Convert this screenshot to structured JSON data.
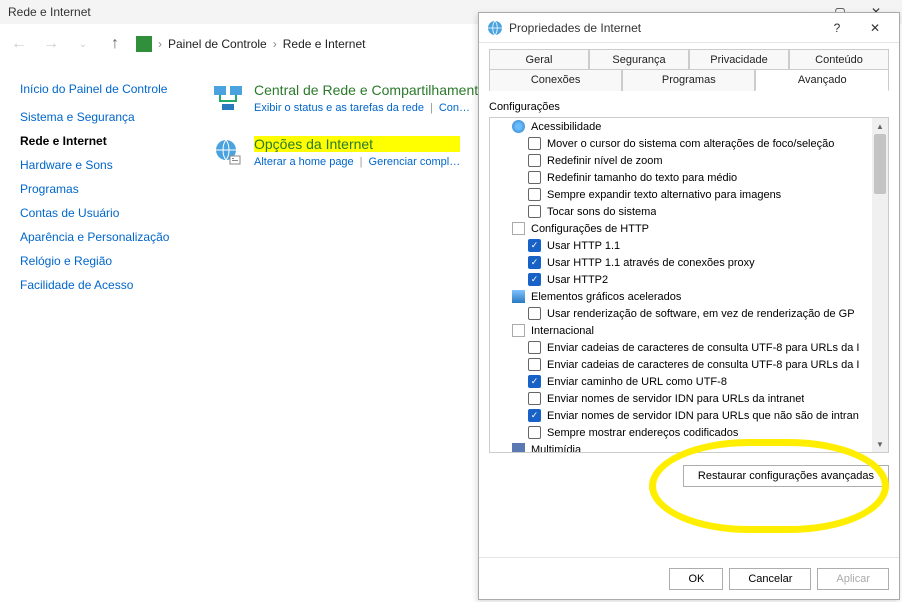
{
  "cp": {
    "title": "Rede e Internet",
    "breadcrumb": {
      "root": "Painel de Controle",
      "current": "Rede e Internet"
    },
    "home_link": "Início do Painel de Controle",
    "categories": [
      {
        "label": "Sistema e Segurança",
        "active": false
      },
      {
        "label": "Rede e Internet",
        "active": true
      },
      {
        "label": "Hardware e Sons",
        "active": false
      },
      {
        "label": "Programas",
        "active": false
      },
      {
        "label": "Contas de Usuário",
        "active": false
      },
      {
        "label": "Aparência e Personalização",
        "active": false
      },
      {
        "label": "Relógio e Região",
        "active": false
      },
      {
        "label": "Facilidade de Acesso",
        "active": false
      }
    ],
    "items": [
      {
        "title": "Central de Rede e Compartilhamento",
        "highlight": false,
        "links": [
          "Exibir o status e as tarefas da rede",
          "Con…"
        ]
      },
      {
        "title": "Opções da Internet",
        "highlight": true,
        "links": [
          "Alterar a home page",
          "Gerenciar compl…"
        ]
      }
    ]
  },
  "dialog": {
    "title": "Propriedades de Internet",
    "tabs_row1": [
      "Geral",
      "Segurança",
      "Privacidade",
      "Conteúdo"
    ],
    "tabs_row2": [
      "Conexões",
      "Programas",
      "Avançado"
    ],
    "active_tab": "Avançado",
    "group_label": "Configurações",
    "tree": [
      {
        "type": "group",
        "icon": "acc",
        "label": "Acessibilidade"
      },
      {
        "type": "check",
        "checked": false,
        "label": "Mover o cursor do sistema com alterações de foco/seleção"
      },
      {
        "type": "check",
        "checked": false,
        "label": "Redefinir nível de zoom"
      },
      {
        "type": "check",
        "checked": false,
        "label": "Redefinir tamanho do texto para médio"
      },
      {
        "type": "check",
        "checked": false,
        "label": "Sempre expandir texto alternativo para imagens"
      },
      {
        "type": "check",
        "checked": false,
        "label": "Tocar sons do sistema"
      },
      {
        "type": "group",
        "icon": "http",
        "label": "Configurações de HTTP"
      },
      {
        "type": "check",
        "checked": true,
        "label": "Usar HTTP 1.1"
      },
      {
        "type": "check",
        "checked": true,
        "label": "Usar HTTP 1.1 através de conexões proxy"
      },
      {
        "type": "check",
        "checked": true,
        "label": "Usar HTTP2"
      },
      {
        "type": "group",
        "icon": "gfx",
        "label": "Elementos gráficos acelerados"
      },
      {
        "type": "check",
        "checked": false,
        "label": "Usar renderização de software, em vez de renderização de GP"
      },
      {
        "type": "group",
        "icon": "intl",
        "label": "Internacional"
      },
      {
        "type": "check",
        "checked": false,
        "label": "Enviar cadeias de caracteres de consulta UTF-8 para URLs da I"
      },
      {
        "type": "check",
        "checked": false,
        "label": "Enviar cadeias de caracteres de consulta UTF-8 para URLs da I"
      },
      {
        "type": "check",
        "checked": true,
        "label": "Enviar caminho de URL como UTF-8"
      },
      {
        "type": "check",
        "checked": false,
        "label": "Enviar nomes de servidor IDN para URLs da intranet"
      },
      {
        "type": "check",
        "checked": true,
        "label": "Enviar nomes de servidor IDN para URLs que não são de intran"
      },
      {
        "type": "check",
        "checked": false,
        "label": "Sempre mostrar endereços codificados"
      },
      {
        "type": "group",
        "icon": "mm",
        "label": "Multimídia"
      }
    ],
    "restore_button": "Restaurar configurações avançadas",
    "footer": {
      "ok": "OK",
      "cancel": "Cancelar",
      "apply": "Aplicar"
    }
  }
}
